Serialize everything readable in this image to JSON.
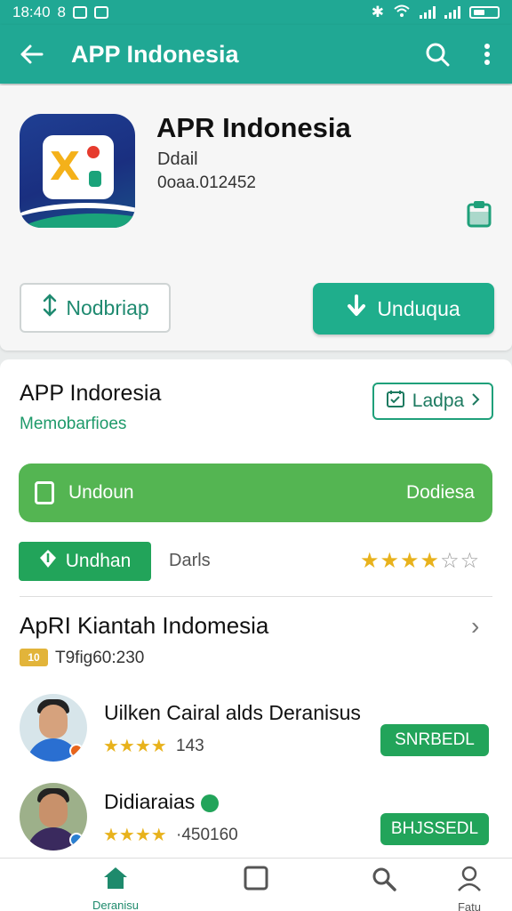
{
  "status_bar": {
    "time": "18:40",
    "left_glyph": "8"
  },
  "app_bar": {
    "title": "APP Indonesia"
  },
  "app_card": {
    "name": "APR Indonesia",
    "subtitle": "Ddail",
    "code": "0oaa.012452",
    "secondary_button": "Nodbriap",
    "primary_button": "Unduqua"
  },
  "info_card": {
    "title": "APP Indoresia",
    "subtitle": "Memobarfioes",
    "badge_button": "Ladpa",
    "banner_left": "Undoun",
    "banner_right": "Dodiesa",
    "chip_button": "Undhan",
    "chip_label": "Darls",
    "rating_stars": 4,
    "rating_max": 6,
    "section_title": "ApRI Kiantah Indomesia",
    "tag_badge": "10",
    "tag_text": "T9fig60:230"
  },
  "reviews": [
    {
      "name": "Uilken Cairal alds Deranisus",
      "stars": "★★★★",
      "count": "143",
      "button": "SNRBEDL"
    },
    {
      "name": "Didiaraias",
      "stars": "★★★★",
      "count": "·450160",
      "button": "BHJSSEDL"
    }
  ],
  "bottom_nav": [
    {
      "label": "Deranisu",
      "icon": "home-icon"
    },
    {
      "label": "",
      "icon": "square-icon"
    },
    {
      "label": "",
      "icon": "search-tool-icon"
    },
    {
      "label": "Fatu",
      "icon": "profile-icon"
    }
  ],
  "colors": {
    "primary": "#20a894",
    "accent_green": "#22a45a",
    "banner_green": "#54b552",
    "star": "#e8b21c"
  }
}
